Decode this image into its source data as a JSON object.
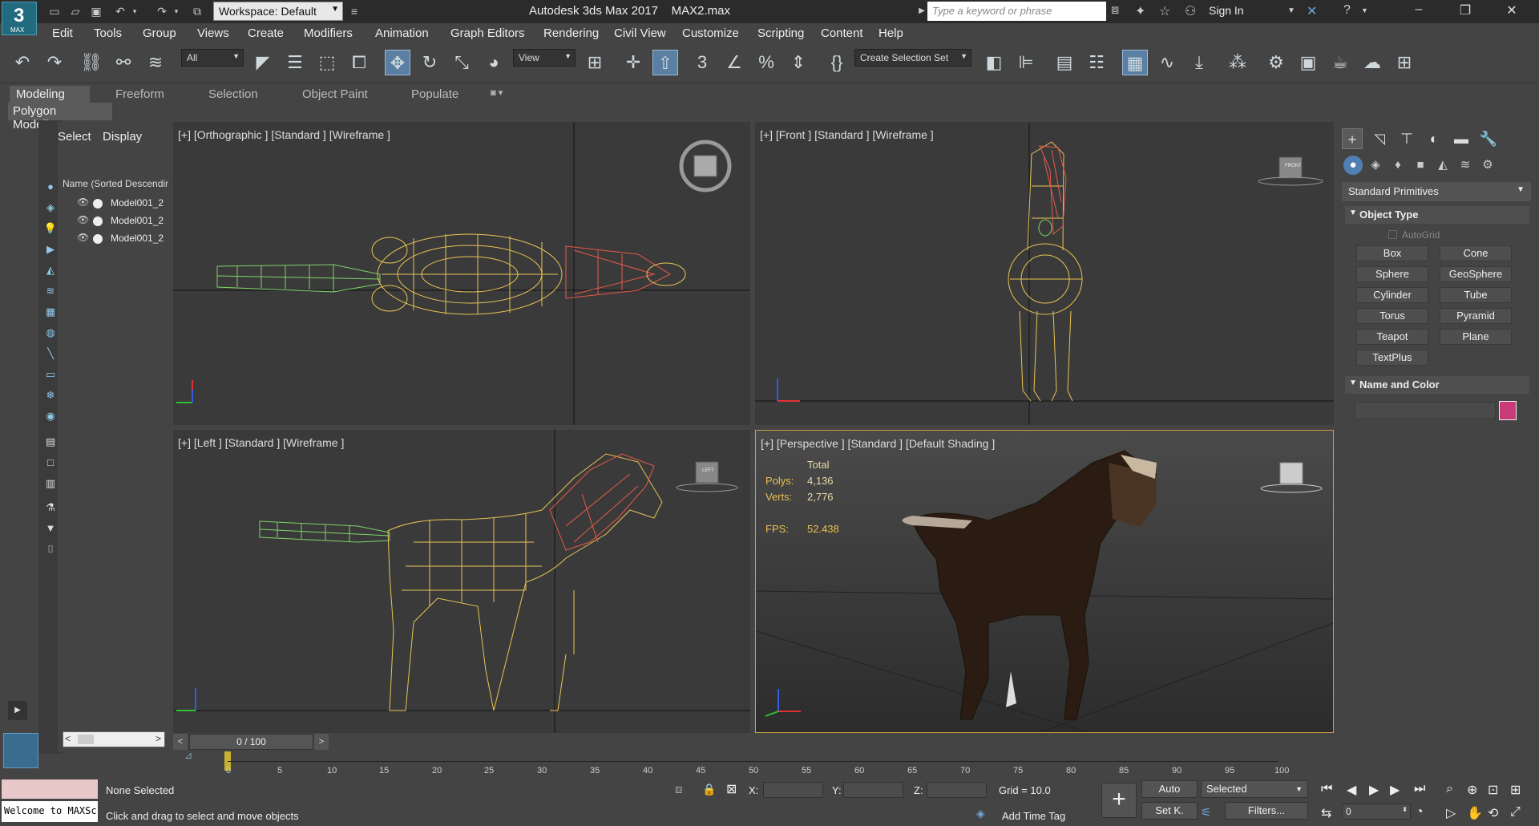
{
  "app": {
    "logo_text": "3",
    "logo_sub": "MAX",
    "title": "Autodesk 3ds Max 2017",
    "file": "MAX2.max",
    "workspace": "Workspace: Default",
    "search_placeholder": "Type a keyword or phrase",
    "sign_in": "Sign In"
  },
  "menus": [
    "Edit",
    "Tools",
    "Group",
    "Views",
    "Create",
    "Modifiers",
    "Animation",
    "Graph Editors",
    "Rendering",
    "Civil View",
    "Customize",
    "Scripting",
    "Content",
    "Help"
  ],
  "toolbar": {
    "filter": "All",
    "refcoord": "View",
    "selection_set": "Create Selection Set"
  },
  "ribbon": {
    "tabs": [
      "Modeling",
      "Freeform",
      "Selection",
      "Object Paint",
      "Populate"
    ],
    "sub": "Polygon Modeling"
  },
  "scene_explorer": {
    "tabs": [
      "Select",
      "Display"
    ],
    "header": "Name (Sorted Descending)",
    "items": [
      "Model001_2",
      "Model001_2",
      "Model001_2"
    ]
  },
  "viewports": {
    "top_left": "[+] [Orthographic ] [Standard ] [Wireframe ]",
    "top_right": "[+] [Front ] [Standard ] [Wireframe ]",
    "bottom_left": "[+] [Left ] [Standard ] [Wireframe ]",
    "bottom_right": "[+] [Perspective ] [Standard ] [Default Shading ]",
    "viewcube_front": "FRONT",
    "viewcube_left": "LEFT"
  },
  "stats": {
    "total_label": "Total",
    "polys_label": "Polys:",
    "polys": "4,136",
    "verts_label": "Verts:",
    "verts": "2,776",
    "fps_label": "FPS:",
    "fps": "52.438"
  },
  "command_panel": {
    "dropdown": "Standard Primitives",
    "object_type": "Object Type",
    "autogrid": "AutoGrid",
    "primitives": [
      "Box",
      "Cone",
      "Sphere",
      "GeoSphere",
      "Cylinder",
      "Tube",
      "Torus",
      "Pyramid",
      "Teapot",
      "Plane",
      "TextPlus"
    ],
    "name_and_color": "Name and Color",
    "color": "#c83a78"
  },
  "timeline": {
    "frame": "0 / 100",
    "ticks": [
      "0",
      "5",
      "10",
      "15",
      "20",
      "25",
      "30",
      "35",
      "40",
      "45",
      "50",
      "55",
      "60",
      "65",
      "70",
      "75",
      "80",
      "85",
      "90",
      "95",
      "100"
    ]
  },
  "status": {
    "maxscript": "Welcome to MAXScript.",
    "selection": "None Selected",
    "prompt": "Click and drag to select and move objects",
    "x_label": "X:",
    "y_label": "Y:",
    "z_label": "Z:",
    "grid": "Grid = 10.0",
    "add_time_tag": "Add Time Tag",
    "auto": "Auto",
    "set_key": "Set K.",
    "key_mode": "Selected",
    "filters": "Filters...",
    "current_frame": "0"
  }
}
